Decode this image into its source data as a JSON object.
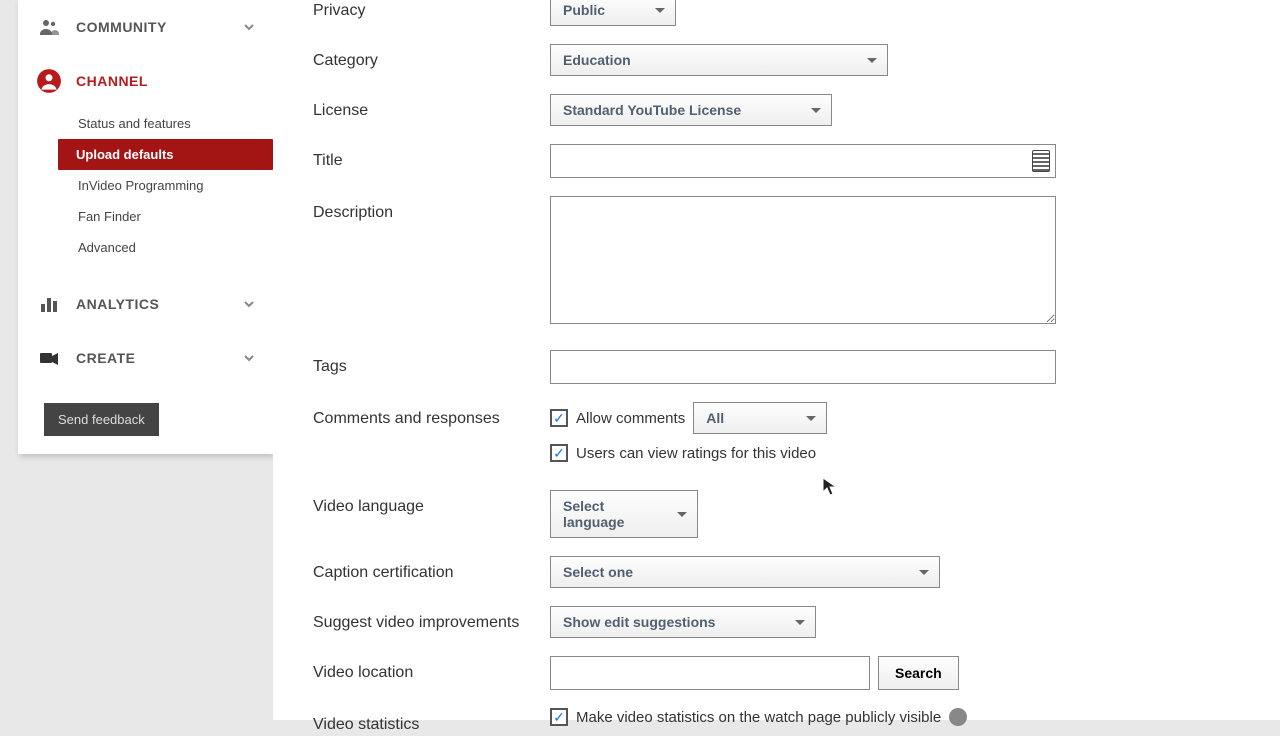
{
  "sidebar": {
    "community": {
      "label": "COMMUNITY"
    },
    "channel": {
      "label": "CHANNEL",
      "items": [
        {
          "label": "Status and features"
        },
        {
          "label": "Upload defaults"
        },
        {
          "label": "InVideo Programming"
        },
        {
          "label": "Fan Finder"
        },
        {
          "label": "Advanced"
        }
      ]
    },
    "analytics": {
      "label": "ANALYTICS"
    },
    "create": {
      "label": "CREATE"
    },
    "feedback": "Send feedback"
  },
  "form": {
    "privacy": {
      "label": "Privacy",
      "value": "Public"
    },
    "category": {
      "label": "Category",
      "value": "Education"
    },
    "license": {
      "label": "License",
      "value": "Standard YouTube License"
    },
    "title": {
      "label": "Title"
    },
    "description": {
      "label": "Description"
    },
    "tags": {
      "label": "Tags"
    },
    "comments": {
      "label": "Comments and responses",
      "allow": "Allow comments",
      "filter": "All",
      "ratings": "Users can view ratings for this video"
    },
    "videolang": {
      "label": "Video language",
      "value": "Select language"
    },
    "caption": {
      "label": "Caption certification",
      "value": "Select one"
    },
    "suggest": {
      "label": "Suggest video improvements",
      "value": "Show edit suggestions"
    },
    "location": {
      "label": "Video location",
      "search": "Search"
    },
    "stats": {
      "label": "Video statistics",
      "public": "Make video statistics on the watch page publicly visible"
    }
  }
}
